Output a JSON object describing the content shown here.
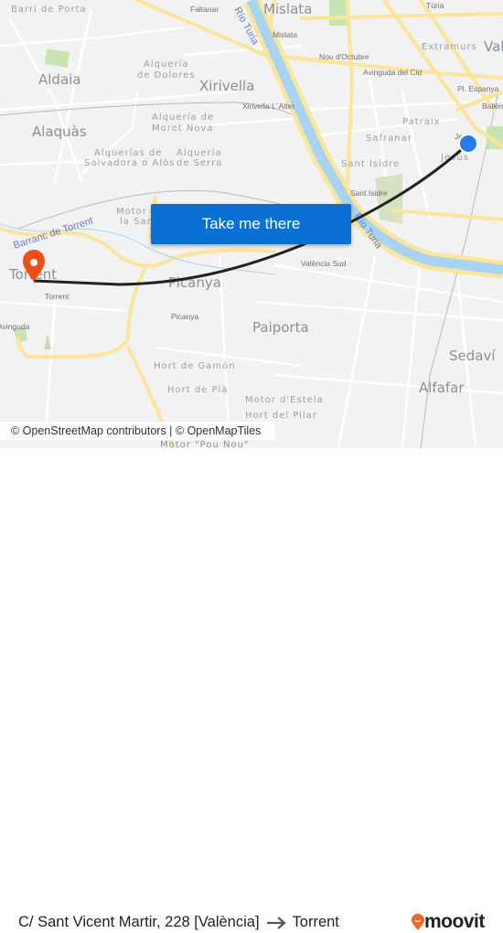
{
  "map": {
    "labels": {
      "barri_de_porta": "Barri de Porta",
      "faltanar": "Faltanar",
      "rio_turia_north": "Río Turia",
      "mislata_big": "Mislata",
      "mislata_small": "Mislata",
      "turia": "Túria",
      "extramurs": "Extramurs",
      "val": "Val",
      "nou_doctubre": "Nou d'Octubre",
      "alqueria_dolores_1": "Alquería",
      "alqueria_dolores_2": "de Dolores",
      "aldaia": "Aldaia",
      "avinguda_del_cid": "Avinguda del Cid",
      "xirivella": "Xirivella",
      "pl_espanya": "Pl. Espanya",
      "ballen": "Ballén",
      "xirivella_alter": "Xirivella L´Alter",
      "moret_nova_1": "Alquería de",
      "moret_nova_2": "Moret Nova",
      "alaquas": "Alaquàs",
      "patraix": "Patraix",
      "safranar": "Safranar",
      "jesus_small": "Jesús",
      "jesus": "Jesús",
      "salvadora_1": "Alquerías de",
      "salvadora_2": "Salvadora o Alòs",
      "serra_1": "Alquería",
      "serra_2": "de Serra",
      "sant_isidre": "Sant Isidre",
      "sant_isidre_small": "Sant Isidre",
      "motor_santa_1": "Motor de",
      "motor_santa_2": "la Santa",
      "barranc_torrent": "Barranc de Torrent",
      "torrent_big": "Torrent",
      "torrent_small": "Torrent",
      "picanya_big": "Picanya",
      "picanya_small": "Picanya",
      "valencia_sud": "València Sud",
      "avinguda": "Avinguda",
      "rio_turia_south": "Río Turia",
      "paiporta": "Paiporta",
      "hort_gamon": "Hort de Gamón",
      "hort_pla": "Hort de Plà",
      "motor_estela": "Motor d'Estela",
      "hort_pilar": "Hort del Pilar",
      "sedavi": "Sedaví",
      "alfafar": "Alfafar",
      "motor_pou_nou": "Motor \"Pou Nou\""
    },
    "origin_marker": {
      "icon": "origin-dot-icon",
      "color": "#2b7bf0"
    },
    "destination_marker": {
      "icon": "map-pin-icon",
      "color": "#f04e12"
    },
    "route_color": "#222222",
    "cta_label": "Take me there",
    "cta_color": "#0a70d4",
    "attribution": "© OpenStreetMap contributors | © OpenMapTiles"
  },
  "footer": {
    "origin": "C/ Sant Vicent Martir, 228 [València]",
    "arrow_icon": "arrow-right-icon",
    "destination": "Torrent",
    "logo_text": "moovit",
    "logo_color": "#f26522"
  }
}
